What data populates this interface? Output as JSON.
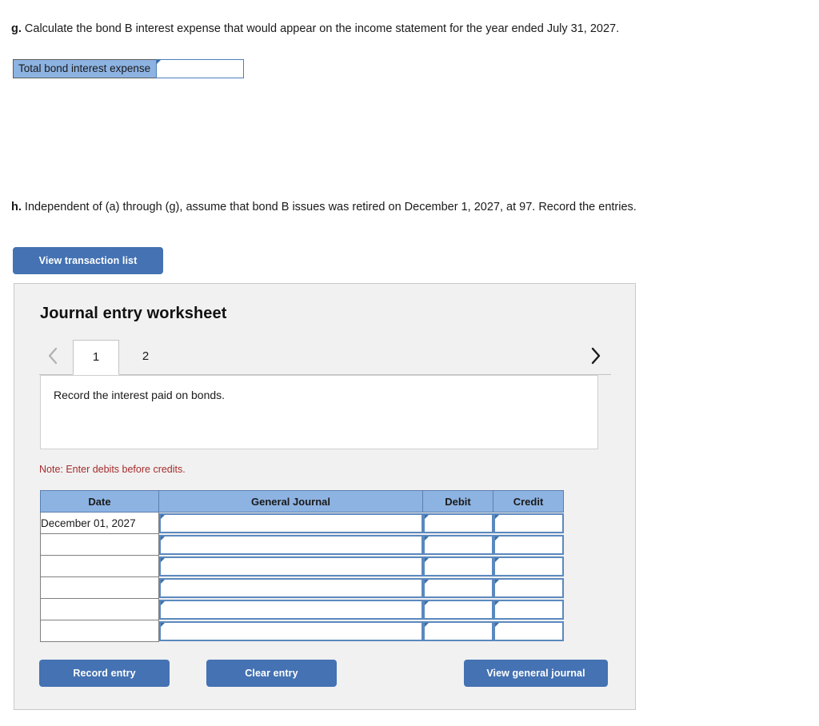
{
  "questions": {
    "g_prefix": "g.",
    "g_text": " Calculate the bond B interest expense that would appear on the income statement for the year ended July 31, 2027.",
    "h_prefix": "h.",
    "h_text": " Independent of (a) through (g), assume that bond B issues was retired on December 1, 2027, at 97. Record the entries."
  },
  "total_field": {
    "label": "Total bond interest expense",
    "value": "",
    "placeholder": ""
  },
  "toolbar": {
    "view_transaction_list_label": "View transaction list"
  },
  "worksheet": {
    "title": "Journal entry worksheet",
    "tabs": [
      {
        "label": "1",
        "active": true
      },
      {
        "label": "2",
        "active": false
      }
    ],
    "prev_icon": "chevron-left-icon",
    "next_icon": "chevron-right-icon",
    "instruction": "Record the interest paid on bonds.",
    "note": "Note: Enter debits before credits.",
    "table": {
      "headers": [
        "Date",
        "General Journal",
        "Debit",
        "Credit"
      ],
      "rows": [
        {
          "date": "December 01, 2027",
          "general_journal": "",
          "debit": "",
          "credit": ""
        },
        {
          "date": "",
          "general_journal": "",
          "debit": "",
          "credit": ""
        },
        {
          "date": "",
          "general_journal": "",
          "debit": "",
          "credit": ""
        },
        {
          "date": "",
          "general_journal": "",
          "debit": "",
          "credit": ""
        },
        {
          "date": "",
          "general_journal": "",
          "debit": "",
          "credit": ""
        },
        {
          "date": "",
          "general_journal": "",
          "debit": "",
          "credit": ""
        }
      ]
    },
    "buttons": {
      "record_entry": "Record entry",
      "clear_entry": "Clear entry",
      "view_general_journal": "View general journal"
    }
  },
  "colors": {
    "button_blue": "#4472b3",
    "header_blue": "#8db3e2",
    "note_red": "#a62c2c",
    "panel_gray": "#f1f1f1",
    "input_border_blue": "#5b89bf"
  }
}
